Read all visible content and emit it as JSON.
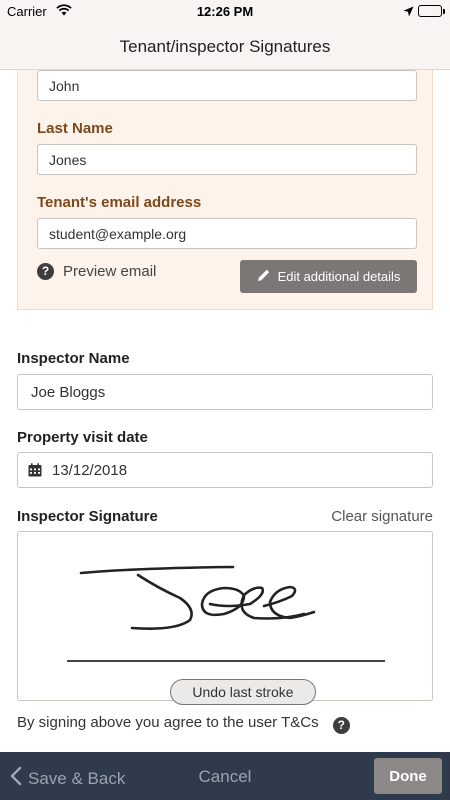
{
  "status_bar": {
    "carrier": "Carrier",
    "time": "12:26 PM"
  },
  "nav": {
    "title": "Tenant/inspector Signatures"
  },
  "tenant": {
    "first_name_value": "John",
    "last_name_label": "Last Name",
    "last_name_value": "Jones",
    "email_label": "Tenant's email address",
    "email_value": "student@example.org",
    "preview_email": "Preview email",
    "edit_details_button": "Edit additional details"
  },
  "inspector": {
    "name_label": "Inspector Name",
    "name_value": "Joe Bloggs",
    "visit_date_label": "Property visit date",
    "visit_date_value": "13/12/2018",
    "signature_label": "Inspector Signature",
    "clear_signature": "Clear signature",
    "undo_button": "Undo last stroke",
    "terms_text": "By signing above you agree to the user T&Cs"
  },
  "bottom_bar": {
    "save_back": "Save & Back",
    "cancel": "Cancel",
    "done": "Done"
  },
  "colors": {
    "accent_brown": "#7a4a1c",
    "tenant_panel_bg": "#fdf3ea",
    "bottom_bar_bg": "#2f3b4c"
  }
}
